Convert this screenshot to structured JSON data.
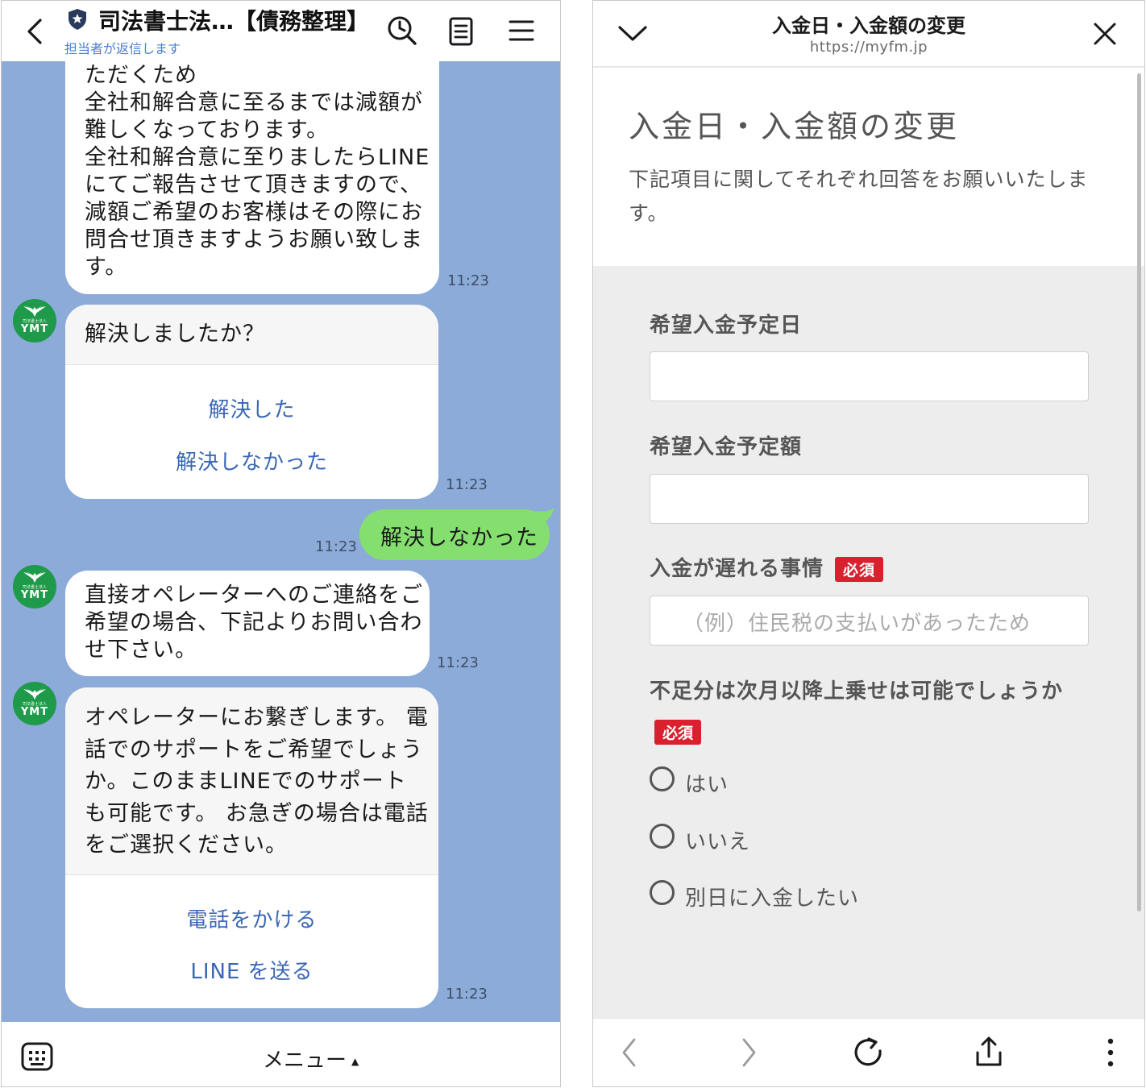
{
  "chat": {
    "title": "司法書士法…【債務整理】",
    "subtitle": "担当者が返信します",
    "messages": {
      "m1": {
        "text": "ただくため\n全社和解合意に至るまでは減額が\n難しくなっております。\n全社和解合意に至りましたらLINE\nにてご報告させて頂きますので、\n減額ご希望のお客様はその際にお\n問合せ頂きますようお願い致しま\nす。",
        "time": "11:23"
      },
      "m2": {
        "question": "解決しましたか？",
        "option_1": "解決した",
        "option_2": "解決しなかった",
        "time": "11:23"
      },
      "m3": {
        "text": "解決しなかった",
        "time": "11:23"
      },
      "m4": {
        "text": "直接オペレーターへのご連絡をご\n希望の場合、下記よりお問い合わ\nせ下さい。",
        "time": "11:23"
      },
      "m5": {
        "text": "オペレーターにお繋ぎします。 電\n話でのサポートをご希望でしょう\nか。このままLINEでのサポート\nも可能です。 お急ぎの場合は電話\nをご選択ください。",
        "option_1": "電話をかける",
        "option_2": "LINE を送る",
        "time": "11:23"
      }
    },
    "avatar": {
      "small_text": "司法書士法人",
      "label": "YMT"
    },
    "menu_label": "メニュー",
    "menu_caret": "▲"
  },
  "browser": {
    "header_title": "入金日・入金額の変更",
    "url": "https://myfm.jp",
    "form": {
      "title": "入金日・入金額の変更",
      "description": "下記項目に関してそれぞれ回答をお願いいたします。",
      "required_badge": "必須",
      "fields": {
        "date": {
          "label": "希望入金予定日",
          "value": ""
        },
        "amount": {
          "label": "希望入金予定額",
          "value": ""
        },
        "reason": {
          "label": "入金が遅れる事情",
          "placeholder": "（例）住民税の支払いがあったため"
        }
      },
      "question": "不足分は次月以降上乗せは可能でしょうか",
      "options": [
        "はい",
        "いいえ",
        "別日に入金したい"
      ]
    }
  },
  "colors": {
    "chat_background": "#8cabd9",
    "green_bubble": "#84df6e",
    "link_blue": "#3b67b3",
    "required_red": "#d9202e",
    "avatar_green": "#1e9a4a"
  }
}
